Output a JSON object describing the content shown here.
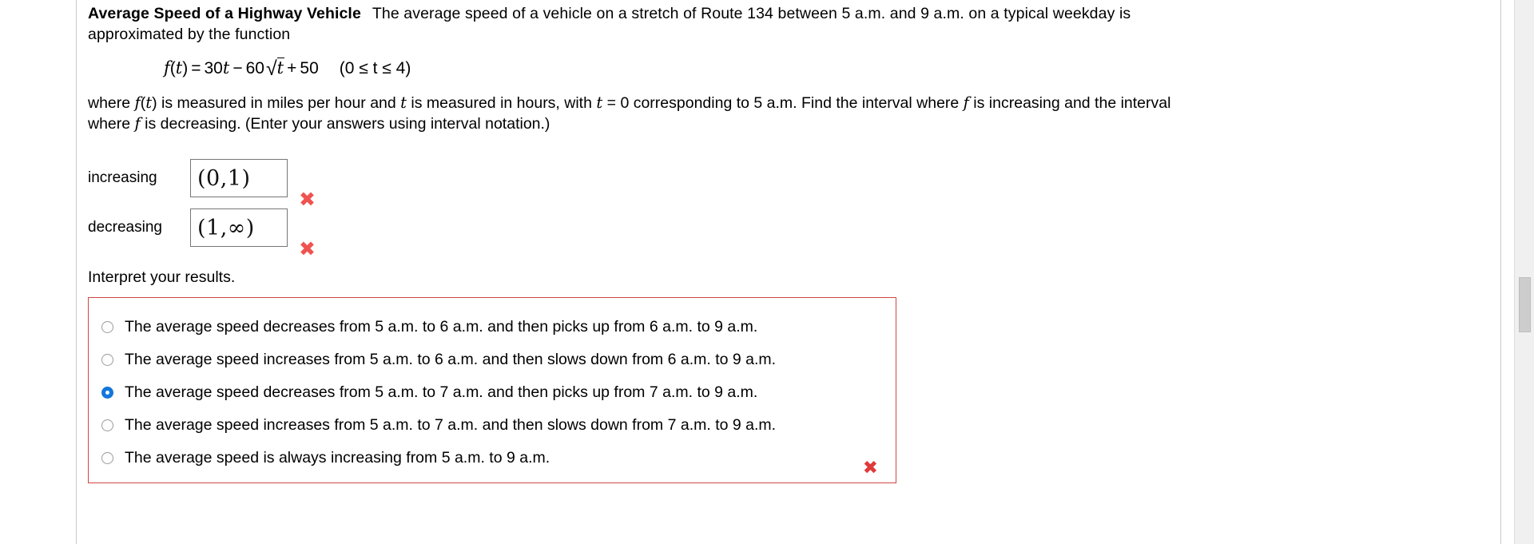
{
  "problem": {
    "title": "Average Speed of a Highway Vehicle",
    "intro": "The average speed of a vehicle on a stretch of Route 134 between 5 a.m. and 9 a.m. on a typical weekday is approximated by the function",
    "formula": {
      "fn": "f",
      "open_paren": "(",
      "var": "t",
      "close_paren": ")",
      "equals": "=",
      "term1_coeff": "30",
      "term1_var": "t",
      "minus": "−",
      "term2_coeff": "60",
      "sqrt": "√",
      "term2_var": "t",
      "plus": "+",
      "constant": "50",
      "domain": "(0 ≤ t ≤ 4)",
      "plain": "f(t) = 30t − 60√t + 50   (0 ≤ t ≤ 4)"
    },
    "where_text_1": "where ",
    "where_fn": "f",
    "where_fn_paren_open": "(",
    "where_fn_var": "t",
    "where_fn_paren_close": ")",
    "where_text_2": " is measured in miles per hour and ",
    "where_var_t": "t",
    "where_text_3": " is measured in hours, with ",
    "where_var_t2": "t",
    "where_text_4": " = 0 corresponding to 5 a.m. Find the interval where ",
    "where_var_f": "f",
    "where_text_5": " is increasing and the interval where ",
    "where_var_f2": "f",
    "where_text_6": " is decreasing. (Enter your answers using interval notation.)"
  },
  "answers": [
    {
      "label": "increasing",
      "value": "(0,1)",
      "status": "incorrect",
      "status_mark": "✖"
    },
    {
      "label": "decreasing",
      "value": "(1,∞)",
      "status": "incorrect",
      "status_mark": "✖"
    }
  ],
  "interpret": {
    "prompt": "Interpret your results.",
    "status_mark": "✖",
    "status": "incorrect",
    "border_color": "#d14545",
    "selected_index": 2,
    "options": [
      {
        "label": "The average speed decreases from 5 a.m. to 6 a.m. and then picks up from 6 a.m. to 9 a.m.",
        "selected": false
      },
      {
        "label": "The average speed increases from 5 a.m. to 6 a.m. and then slows down from 6 a.m. to 9 a.m.",
        "selected": false
      },
      {
        "label": "The average speed decreases from 5 a.m. to 7 a.m. and then picks up from 7 a.m. to 9 a.m.",
        "selected": true
      },
      {
        "label": "The average speed increases from 5 a.m. to 7 a.m. and then slows down from 7 a.m. to 9 a.m.",
        "selected": false
      },
      {
        "label": "The average speed is always increasing from 5 a.m. to 9 a.m.",
        "selected": false
      }
    ]
  },
  "colors": {
    "incorrect_mark": "#ef5350",
    "selected_radio": "#1277dd",
    "error_border": "#d14545"
  }
}
